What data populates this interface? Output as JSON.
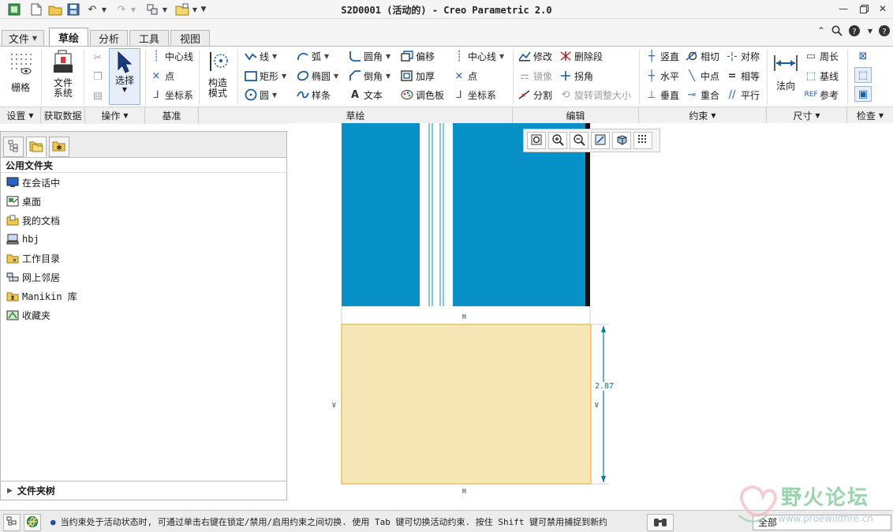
{
  "window": {
    "title": "S2D0001 (活动的) - Creo Parametric 2.0"
  },
  "colors": {
    "accent": "#1b5ea8",
    "sketch_blue": "#0891c6",
    "sketch_fill": "#f7e7b7",
    "dimension": "#007a9e"
  },
  "tabs": [
    {
      "label": "文件",
      "has_dropdown": true
    },
    {
      "label": "草绘",
      "active": true
    },
    {
      "label": "分析"
    },
    {
      "label": "工具"
    },
    {
      "label": "视图"
    }
  ],
  "ribbon": {
    "grid_label": "栅格",
    "file_system_label": "文件\n系统",
    "select_label": "选择",
    "datum": {
      "centerline": "中心线",
      "point": "点",
      "coord_sys": "坐标系"
    },
    "construction_label": "构造\n模式",
    "sketch": {
      "line": "线",
      "rectangle": "矩形",
      "circle": "圆",
      "arc": "弧",
      "ellipse": "椭圆",
      "spline": "样条",
      "fillet": "圆角",
      "chamfer": "倒角",
      "text": "文本",
      "offset": "偏移",
      "thicken": "加厚",
      "palette": "调色板",
      "centerline": "中心线",
      "point": "点",
      "coord_sys": "坐标系"
    },
    "edit": {
      "modify": "修改",
      "delete_segment": "删除段",
      "mirror": "镜像",
      "corner": "拐角",
      "divide": "分割",
      "rotate_resize": "旋转调整大小"
    },
    "constrain": {
      "vertical": "竖直",
      "tangent": "相切",
      "symmetric": "对称",
      "horizontal": "水平",
      "midpoint": "中点",
      "equal": "相等",
      "perpendicular": "垂直",
      "coincident": "重合",
      "parallel": "平行"
    },
    "dimension": {
      "normal": "法向",
      "perimeter": "周长",
      "baseline": "基线",
      "reference": "参考"
    },
    "groups": {
      "setup": "设置",
      "get_data": "获取数据",
      "operations": "操作",
      "datum": "基准",
      "sketching": "草绘",
      "editing": "编辑",
      "constrain": "约束",
      "dimension": "尺寸",
      "inspect": "检查"
    }
  },
  "left_panel": {
    "header": "公用文件夹",
    "items": [
      {
        "label": "在会话中",
        "icon": "monitor-icon"
      },
      {
        "label": "桌面",
        "icon": "desktop-icon"
      },
      {
        "label": "我的文档",
        "icon": "documents-folder-icon"
      },
      {
        "label": "hbj",
        "icon": "computer-icon"
      },
      {
        "label": "工作目录",
        "icon": "working-folder-icon"
      },
      {
        "label": "网上邻居",
        "icon": "network-icon"
      },
      {
        "label": "Manikin 库",
        "icon": "library-icon"
      },
      {
        "label": "收藏夹",
        "icon": "favorites-icon"
      }
    ],
    "footer": "文件夹树"
  },
  "sketch": {
    "dim_value": "2.87",
    "h_label": "H",
    "v_label": "V"
  },
  "status": {
    "message": "当约束处于活动状态时, 可通过单击右键在锁定/禁用/启用约束之间切换. 使用 Tab 键可切换活动约束. 按住 Shift 键可禁用捕捉到新约束",
    "filter": "全部"
  },
  "watermark": {
    "text": "野火论坛",
    "url": "www.proewildfire.cn"
  }
}
